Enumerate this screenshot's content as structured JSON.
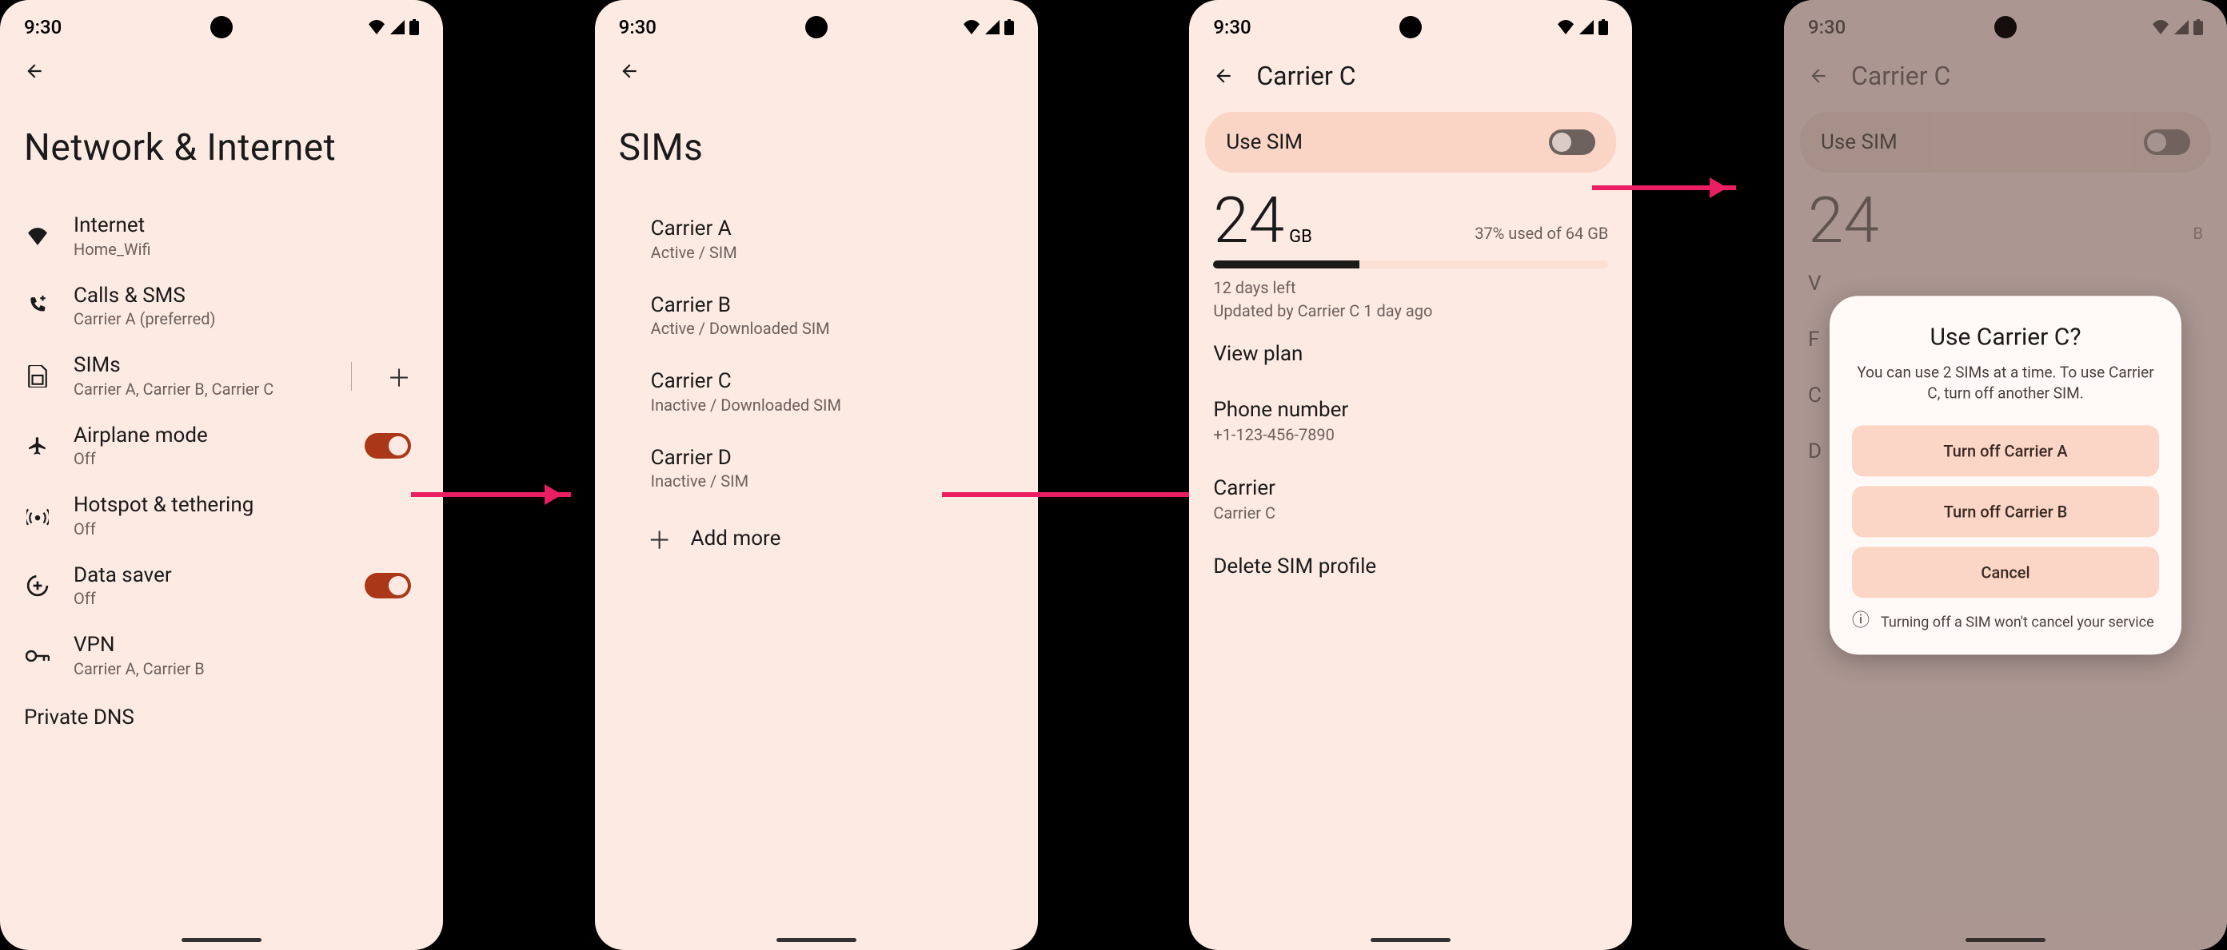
{
  "status": {
    "time": "9:30"
  },
  "screen1": {
    "title": "Network & Internet",
    "items": {
      "internet": {
        "title": "Internet",
        "sub": "Home_Wifi"
      },
      "calls": {
        "title": "Calls & SMS",
        "sub": "Carrier A (preferred)"
      },
      "sims": {
        "title": "SIMs",
        "sub": "Carrier A, Carrier B, Carrier C"
      },
      "airplane": {
        "title": "Airplane mode",
        "sub": "Off"
      },
      "hotspot": {
        "title": "Hotspot & tethering",
        "sub": "Off"
      },
      "datasaver": {
        "title": "Data saver",
        "sub": "Off"
      },
      "vpn": {
        "title": "VPN",
        "sub": "Carrier A, Carrier B"
      },
      "privatedns": {
        "title": "Private DNS"
      }
    }
  },
  "screen2": {
    "title": "SIMs",
    "sims": {
      "a": {
        "name": "Carrier A",
        "status": "Active / SIM"
      },
      "b": {
        "name": "Carrier B",
        "status": "Active / Downloaded SIM"
      },
      "c": {
        "name": "Carrier C",
        "status": "Inactive / Downloaded SIM"
      },
      "d": {
        "name": "Carrier D",
        "status": "Inactive / SIM"
      }
    },
    "add": "Add more"
  },
  "screen3": {
    "title": "Carrier C",
    "use_sim": "Use SIM",
    "usage": {
      "value": "24",
      "unit": "GB",
      "pct_text": "37% used of 64 GB",
      "days": "12 days left",
      "updated": "Updated by Carrier C 1 day ago"
    },
    "view_plan": "View plan",
    "phone": {
      "label": "Phone number",
      "value": "+1-123-456-7890"
    },
    "carrier": {
      "label": "Carrier",
      "value": "Carrier C"
    },
    "delete": "Delete SIM profile"
  },
  "screen4": {
    "title": "Carrier C",
    "use_sim": "Use SIM",
    "dialog": {
      "title": "Use Carrier C?",
      "msg": "You can use 2 SIMs at a time. To use Carrier C, turn off another SIM.",
      "btn_a": "Turn off Carrier A",
      "btn_b": "Turn off Carrier B",
      "btn_cancel": "Cancel",
      "info": "Turning off a SIM won't cancel your service"
    },
    "partial": {
      "num": "24",
      "v": "V",
      "f": "F",
      "c": "C",
      "d": "D"
    }
  }
}
